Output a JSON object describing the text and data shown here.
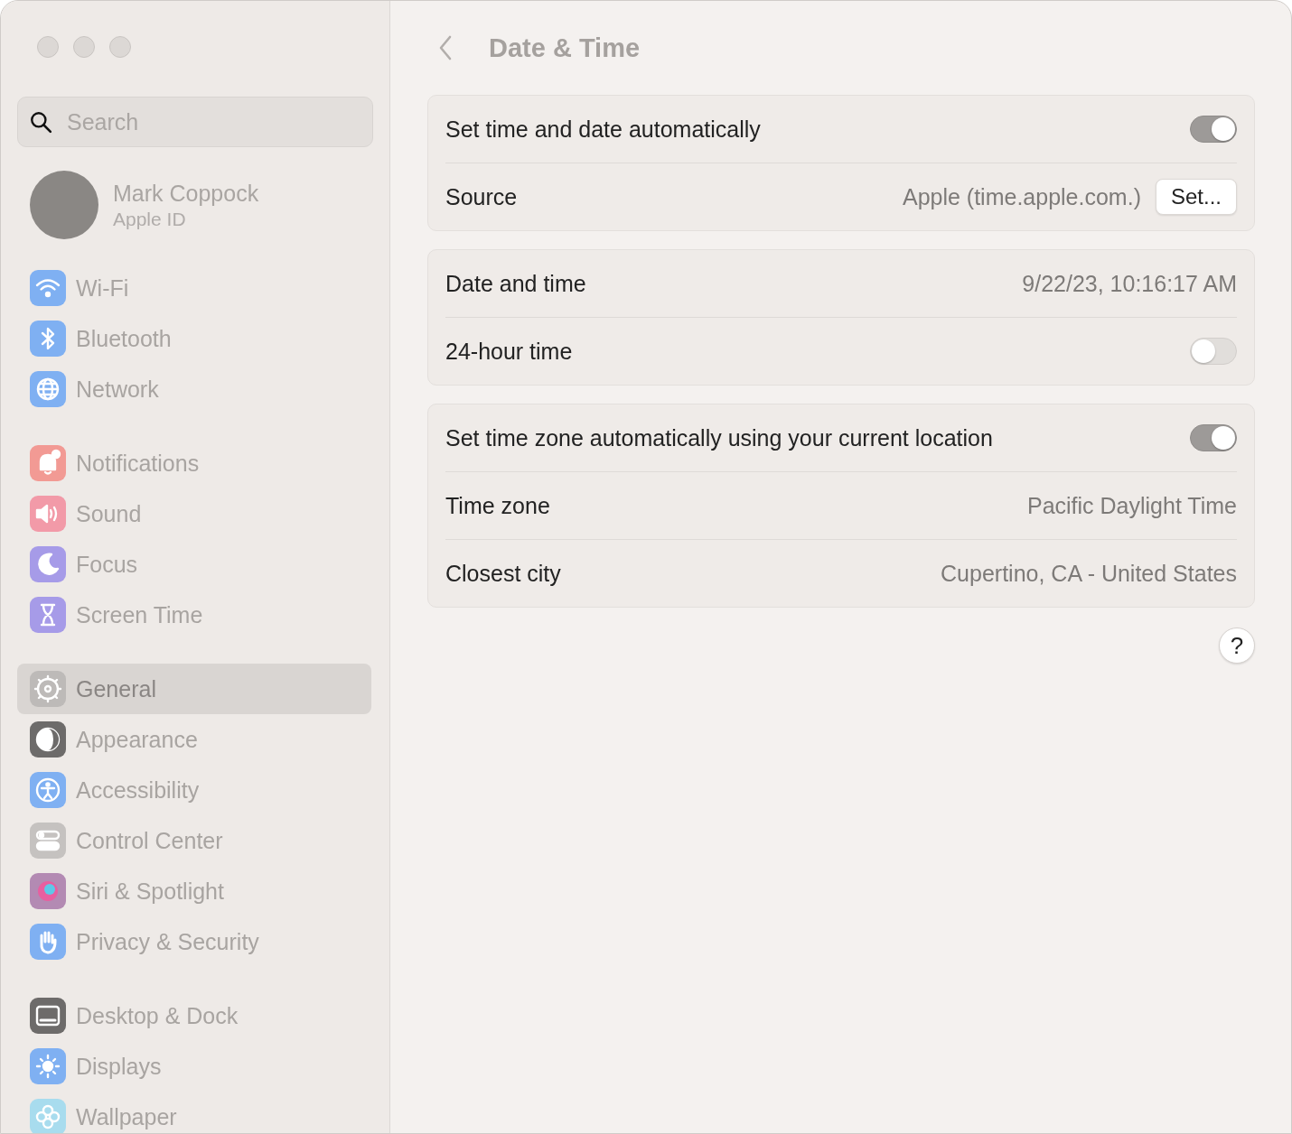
{
  "window": {
    "title": "Date & Time"
  },
  "search": {
    "placeholder": "Search"
  },
  "account": {
    "name": "Mark Coppock",
    "subtitle": "Apple ID"
  },
  "sidebar": {
    "groups": [
      {
        "items": [
          {
            "label": "Wi-Fi",
            "color": "#7fb0f2",
            "selected": false
          },
          {
            "label": "Bluetooth",
            "color": "#7fb0f2",
            "selected": false
          },
          {
            "label": "Network",
            "color": "#7fb0f2",
            "selected": false
          }
        ]
      },
      {
        "items": [
          {
            "label": "Notifications",
            "color": "#f29a94",
            "selected": false
          },
          {
            "label": "Sound",
            "color": "#f29aa8",
            "selected": false
          },
          {
            "label": "Focus",
            "color": "#a69be8",
            "selected": false
          },
          {
            "label": "Screen Time",
            "color": "#a69be8",
            "selected": false
          }
        ]
      },
      {
        "items": [
          {
            "label": "General",
            "color": "#bdbab8",
            "selected": true
          },
          {
            "label": "Appearance",
            "color": "#6d6b6a",
            "selected": false
          },
          {
            "label": "Accessibility",
            "color": "#7fb0f2",
            "selected": false
          },
          {
            "label": "Control Center",
            "color": "#c5c2c0",
            "selected": false
          },
          {
            "label": "Siri & Spotlight",
            "color": "#b38ab3",
            "selected": false
          },
          {
            "label": "Privacy & Security",
            "color": "#7fb0f2",
            "selected": false
          }
        ]
      },
      {
        "items": [
          {
            "label": "Desktop & Dock",
            "color": "#6d6b6a",
            "selected": false
          },
          {
            "label": "Displays",
            "color": "#7fb0f2",
            "selected": false
          },
          {
            "label": "Wallpaper",
            "color": "#a8dcee",
            "selected": false
          }
        ]
      }
    ]
  },
  "cards": [
    {
      "rows": [
        {
          "kind": "toggle",
          "label": "Set time and date automatically",
          "on": true
        },
        {
          "kind": "value_button",
          "label": "Source",
          "value": "Apple (time.apple.com.)",
          "button": "Set..."
        }
      ]
    },
    {
      "rows": [
        {
          "kind": "value",
          "label": "Date and time",
          "value": "9/22/23, 10:16:17 AM"
        },
        {
          "kind": "toggle",
          "label": "24-hour time",
          "on": false
        }
      ]
    },
    {
      "rows": [
        {
          "kind": "toggle",
          "label": "Set time zone automatically using your current location",
          "on": true
        },
        {
          "kind": "value",
          "label": "Time zone",
          "value": "Pacific Daylight Time"
        },
        {
          "kind": "value",
          "label": "Closest city",
          "value": "Cupertino, CA - United States"
        }
      ]
    }
  ],
  "help_button": "?"
}
